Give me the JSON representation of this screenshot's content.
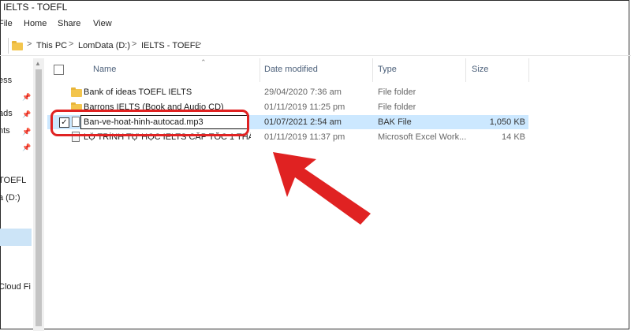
{
  "window": {
    "title": "IELTS - TOEFL"
  },
  "ribbon": {
    "tabs": [
      "File",
      "Home",
      "Share",
      "View"
    ]
  },
  "address": {
    "path": [
      "This PC",
      "LomData (D:)",
      "IELTS - TOEFL"
    ],
    "separators": [
      ">",
      ">",
      ">",
      ">"
    ]
  },
  "nav": {
    "items": [
      "ess",
      "ads",
      "nts",
      "",
      "TOEFL",
      "a (D:)",
      "",
      "",
      "",
      "",
      "Cloud Fi",
      ""
    ]
  },
  "columns": {
    "name": "Name",
    "date": "Date modified",
    "type": "Type",
    "size": "Size"
  },
  "files": [
    {
      "name": "Bank of ideas TOEFL IELTS",
      "date": "29/04/2020 7:36 am",
      "type": "File folder",
      "size": "",
      "icon": "folder-icon"
    },
    {
      "name": "Barrons IELTS (Book and Audio CD)",
      "date": "01/11/2019 11:25 pm",
      "type": "File folder",
      "size": "",
      "icon": "folder-icon"
    },
    {
      "name": "Ban-ve-hoat-hinh-autocad.mp3",
      "date": "01/07/2021 2:54 am",
      "type": "BAK File",
      "size": "1,050 KB",
      "icon": "file-icon",
      "checked": "✓"
    },
    {
      "name": "LỘ TRÌNH TỰ HỌC IELTS CẤP TỐC 1 THÁNG...",
      "date": "01/11/2019 11:37 pm",
      "type": "Microsoft Excel Work...",
      "size": "14 KB",
      "icon": "excel-icon"
    }
  ],
  "colors": {
    "selection": "#cce8ff",
    "annotation": "#e02222",
    "folder": "#f3c54d"
  }
}
